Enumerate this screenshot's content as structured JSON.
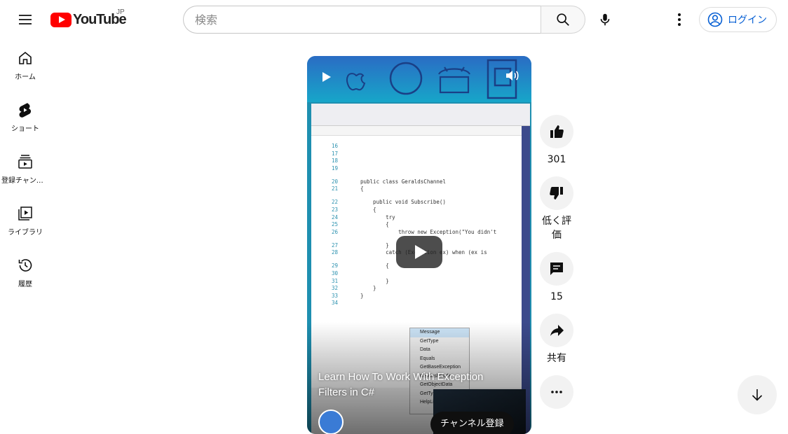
{
  "header": {
    "logo_text": "YouTube",
    "country_code": "JP",
    "search_placeholder": "検索",
    "login_label": "ログイン"
  },
  "sidebar": {
    "items": [
      {
        "label": "ホーム",
        "icon": "home-icon"
      },
      {
        "label": "ショート",
        "icon": "shorts-icon"
      },
      {
        "label": "登録チャンネル",
        "icon": "subscriptions-icon"
      },
      {
        "label": "ライブラリ",
        "icon": "library-icon"
      },
      {
        "label": "履歴",
        "icon": "history-icon"
      }
    ]
  },
  "video": {
    "title": "Learn How To Work With Exception Filters in C#",
    "subscribe_label": "チャンネル登録",
    "code": {
      "lines": [
        {
          "n": "16",
          "text": ""
        },
        {
          "n": "17",
          "text": ""
        },
        {
          "n": "18",
          "text": ""
        },
        {
          "n": "19",
          "text": ""
        },
        {
          "n": "20",
          "text": "public class GeraldsChannel"
        },
        {
          "n": "21",
          "text": "{"
        },
        {
          "n": "22",
          "text": "    public void Subscribe()"
        },
        {
          "n": "23",
          "text": "    {"
        },
        {
          "n": "24",
          "text": "        try"
        },
        {
          "n": "25",
          "text": "        {"
        },
        {
          "n": "26",
          "text": "            throw new Exception(\"You didn't"
        },
        {
          "n": "27",
          "text": "        }"
        },
        {
          "n": "28",
          "text": "        catch (Exception ex) when (ex is"
        },
        {
          "n": "29",
          "text": "        {"
        },
        {
          "n": "30",
          "text": ""
        },
        {
          "n": "31",
          "text": "        }"
        },
        {
          "n": "32",
          "text": "    }"
        },
        {
          "n": "33",
          "text": "}"
        },
        {
          "n": "34",
          "text": ""
        }
      ],
      "intellisense": [
        "Message",
        "GetType",
        "Data",
        "Equals",
        "GetBaseException",
        "GetHashCode",
        "GetObjectData",
        "GetType",
        "HelpLink"
      ]
    }
  },
  "actions": {
    "like_count": "301",
    "dislike_label": "低く評価",
    "comment_count": "15",
    "share_label": "共有"
  }
}
